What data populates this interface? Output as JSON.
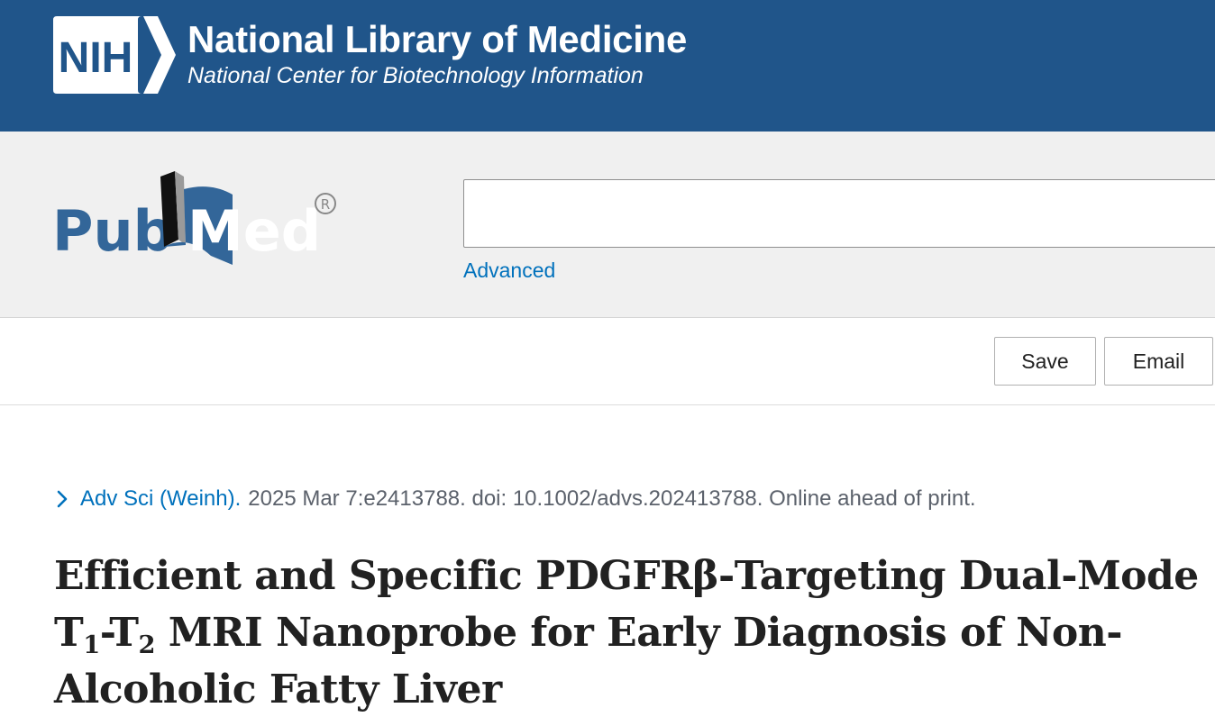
{
  "header": {
    "nih_abbrev": "NIH",
    "title": "National Library of Medicine",
    "subtitle": "National Center for Biotechnology Information"
  },
  "search": {
    "logo_text_left": "Pub",
    "logo_text_right": "Med",
    "logo_mark": "®",
    "value": "",
    "placeholder": "",
    "advanced_label": "Advanced"
  },
  "toolbar": {
    "save_label": "Save",
    "email_label": "Email"
  },
  "article": {
    "journal": "Adv Sci (Weinh).",
    "citation": "2025 Mar 7:e2413788. doi: 10.1002/advs.202413788. Online ahead of print.",
    "title_parts": {
      "p1": "Efficient and Specific PDGFRβ-Targeting Dual-Mode T",
      "sub1": "1",
      "p2": "-T",
      "sub2": "2",
      "p3": " MRI Nanoprobe for Early Diagnosis of Non-Alcoholic Fatty Liver"
    }
  },
  "colors": {
    "banner": "#20558a",
    "link": "#0071bc",
    "search_band": "#f0f0f0"
  },
  "icons": [
    "nih-logo-icon",
    "pubmed-logo-icon",
    "chevron-right-icon"
  ]
}
